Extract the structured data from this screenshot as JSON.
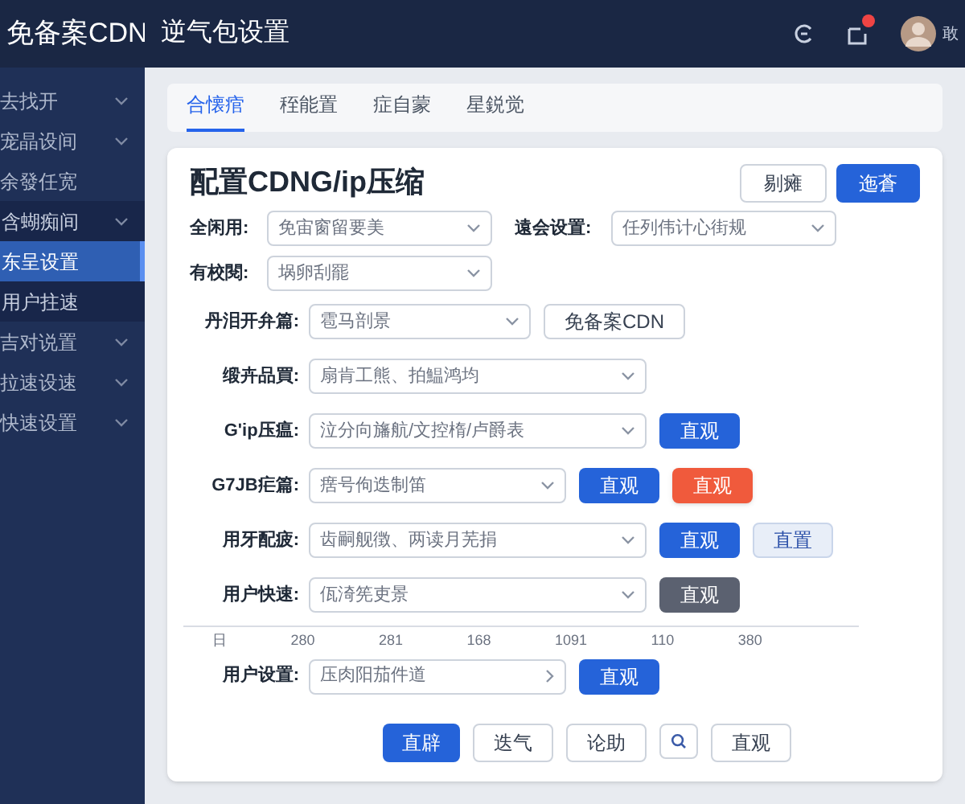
{
  "sidebar": {
    "logo": "免备案CDN",
    "items": [
      {
        "label": "去找开",
        "expandable": true,
        "selected": false,
        "group": false
      },
      {
        "label": "宠晶设间",
        "expandable": true,
        "selected": false,
        "group": false
      },
      {
        "label": "余發任宽",
        "expandable": false,
        "selected": false,
        "group": false
      },
      {
        "label": "含蝴痴间",
        "expandable": true,
        "selected": false,
        "group": true
      },
      {
        "label": "东呈设置",
        "expandable": false,
        "selected": true,
        "group": true
      },
      {
        "label": "用户拄速",
        "expandable": false,
        "selected": false,
        "group": true
      },
      {
        "label": "吉对说置",
        "expandable": true,
        "selected": false,
        "group": false
      },
      {
        "label": "拉速设速",
        "expandable": true,
        "selected": false,
        "group": false
      },
      {
        "label": "快速设置",
        "expandable": true,
        "selected": false,
        "group": false
      }
    ]
  },
  "header": {
    "title": "逆气包设置",
    "notification_dot": true,
    "user": "敢"
  },
  "tabs": [
    {
      "label": "合懐痯",
      "selected": true
    },
    {
      "label": "秷能置",
      "selected": false
    },
    {
      "label": "症自蒙",
      "selected": false
    },
    {
      "label": "星鋭觉",
      "selected": false
    }
  ],
  "card": {
    "title": "配置CDNG/ip压缩",
    "actions": [
      {
        "label": "剔瘫",
        "kind": "outline"
      },
      {
        "label": "迤蒼",
        "kind": "primary"
      }
    ],
    "top_rows": [
      {
        "fields": [
          {
            "label": "全闲用:",
            "value": "免宙窗留要美"
          },
          {
            "label": "遠会设置:",
            "value": "任列伟计心街规"
          }
        ]
      },
      {
        "fields": [
          {
            "label": "有校閱:",
            "value": "埚卵刮罷"
          }
        ]
      }
    ],
    "rows": [
      {
        "label": "丹泪开弁篇:",
        "value": "雹马剖景",
        "kind": "dropdown",
        "buttons": [
          {
            "label": "免备案CDN",
            "kind": "outline"
          }
        ]
      },
      {
        "label": "缎卉品買:",
        "value": "扇肯工熊、拍鰛鸿均",
        "kind": "dropdown",
        "buttons": []
      },
      {
        "label": "G'ip压瘟:",
        "value": "泣分向旛航/文控楕/卢爵表",
        "kind": "dropdown",
        "buttons": [
          {
            "label": "直观",
            "kind": "primary"
          }
        ]
      },
      {
        "label": "G7JB疟篇:",
        "value": "瘔号佝迭制笛",
        "kind": "dropdown",
        "buttons": [
          {
            "label": "直观",
            "kind": "primary"
          },
          {
            "label": "直观",
            "kind": "danger"
          }
        ]
      },
      {
        "label": "用牙配疲:",
        "value": "齿嗣舰徴、两读月芜捐",
        "kind": "dropdown",
        "buttons": [
          {
            "label": "直观",
            "kind": "primary"
          },
          {
            "label": "直置",
            "kind": "light"
          }
        ]
      },
      {
        "label": "用户快速:",
        "value": "佤渏筅吏景",
        "kind": "dropdown",
        "buttons": [
          {
            "label": "直观",
            "kind": "dark"
          }
        ]
      }
    ],
    "ruler": [
      "日",
      "280",
      "281",
      "168",
      "1091",
      "110",
      "380"
    ],
    "last_row": {
      "label": "用户设置:",
      "value": "压肉阳茄件道",
      "kind": "link",
      "buttons": [
        {
          "label": "直观",
          "kind": "primary"
        }
      ]
    },
    "footer": [
      {
        "label": "直辟",
        "kind": "primary"
      },
      {
        "label": "迭气",
        "kind": "outline"
      },
      {
        "label": "论助",
        "kind": "outline"
      },
      {
        "kind": "search"
      },
      {
        "label": "直观",
        "kind": "outline"
      }
    ]
  }
}
